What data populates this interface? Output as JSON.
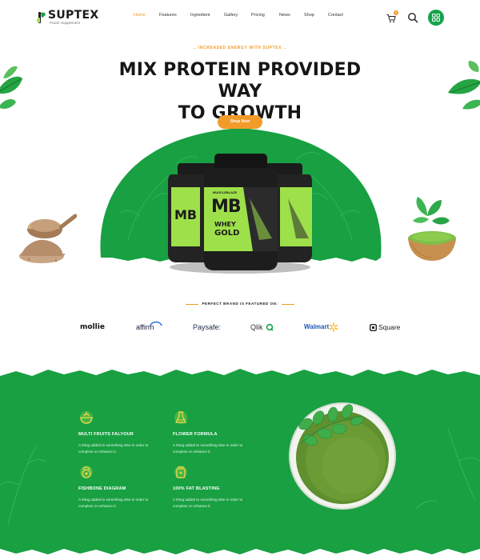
{
  "brand": {
    "name": "SUPTEX",
    "tagline": "Power Supplement"
  },
  "nav": {
    "items": [
      "Home",
      "Features",
      "Ingredient",
      "Gallery",
      "Pricing",
      "News",
      "Shop",
      "Contact"
    ],
    "active": "Home"
  },
  "cart": {
    "count": "0"
  },
  "hero": {
    "eyebrow": ".. INCREASED ENERGY WITH SUPTEX ..",
    "title_line1": "MIX PROTEIN PROVIDED WAY",
    "title_line2": "TO GROWTH",
    "cta": "Shop Now"
  },
  "product": {
    "brand_small": "MUSCLEBLAZE",
    "logo": "MB",
    "name_line1": "WHEY",
    "name_line2": "GOLD"
  },
  "featured": {
    "label": "PERFECT BRAND IS FEATURED ON:",
    "brands": [
      "mollie",
      "affirm",
      "Paysafe:",
      "Qlik",
      "Walmart",
      "Square"
    ]
  },
  "features": [
    {
      "title": "MULTI FRUITS FALYOUR",
      "desc": "A thing added to something else in order to complete or enhance it.",
      "icon": "bowl-icon"
    },
    {
      "title": "FLOWER FORMULA",
      "desc": "A thing added to something else in order to complete or enhance it.",
      "icon": "flask-icon"
    },
    {
      "title": "FISHBONE DIAGRAM",
      "desc": "A thing added to something else in order to complete or enhance it.",
      "icon": "kettlebell-icon"
    },
    {
      "title": "100% FAT BLASTING",
      "desc": "A thing added to something else in order to complete or enhance it.",
      "icon": "jar-icon"
    }
  ],
  "colors": {
    "primary_green": "#18a042",
    "accent_orange": "#f39b2a",
    "lime": "#a6e34a",
    "dark": "#161616"
  }
}
